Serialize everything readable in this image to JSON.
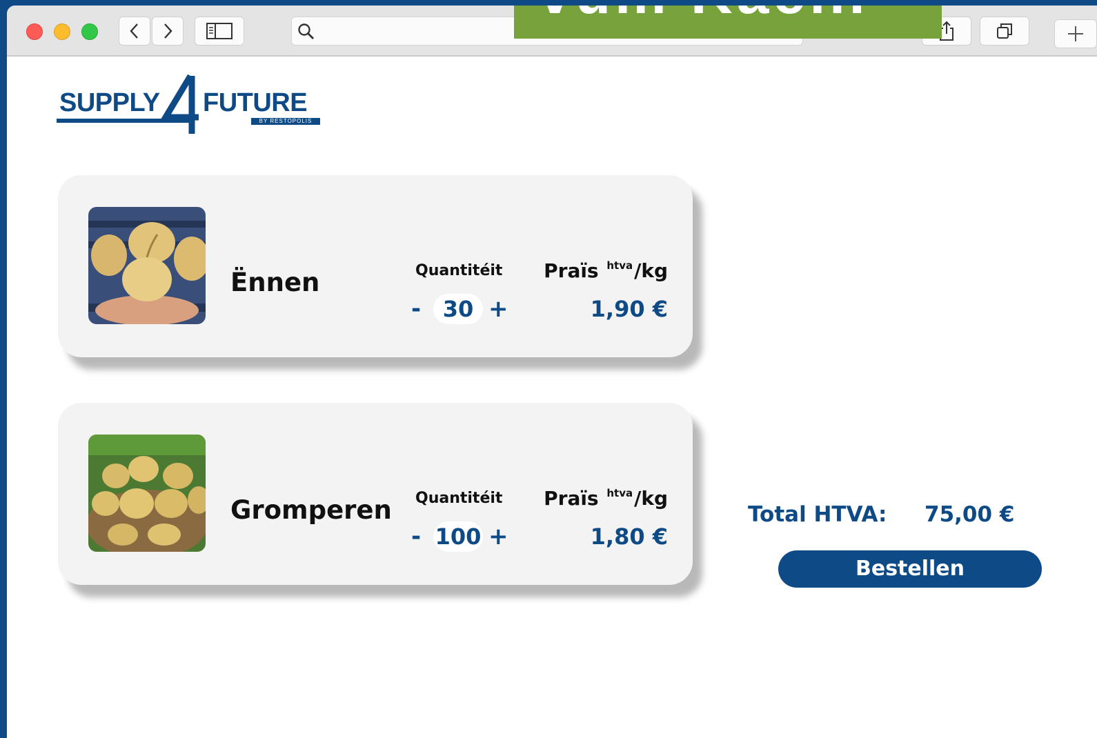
{
  "banner": {
    "text": "vum Kaen."
  },
  "logo": {
    "word1": "SUPPLY",
    "digit": "4",
    "word2": "FUTURE",
    "subtitle": "BY RESTOPOLIS"
  },
  "products": [
    {
      "name": "Ënnen",
      "quantity_label": "Quantitéit",
      "quantity": "30",
      "minus": "-",
      "plus": "+",
      "price_label_main": "Praïs",
      "price_label_sup": "htva",
      "price_label_unit": "/kg",
      "price": "1,90 €"
    },
    {
      "name": "Gromperen",
      "quantity_label": "Quantitéit",
      "quantity": "100",
      "minus": "-",
      "plus": "+",
      "price_label_main": "Praïs",
      "price_label_sup": "htva",
      "price_label_unit": "/kg",
      "price": "1,80 €"
    }
  ],
  "summary": {
    "total_label": "Total HTVA:",
    "total_value": "75,00 €",
    "order_button": "Bestellen"
  },
  "colors": {
    "brand": "#0d4a86",
    "banner": "#78a23c",
    "card": "#f3f3f3"
  },
  "icons": [
    "back-icon",
    "forward-icon",
    "sidebar-icon",
    "search-icon",
    "share-icon",
    "tabs-icon",
    "new-tab-icon"
  ]
}
